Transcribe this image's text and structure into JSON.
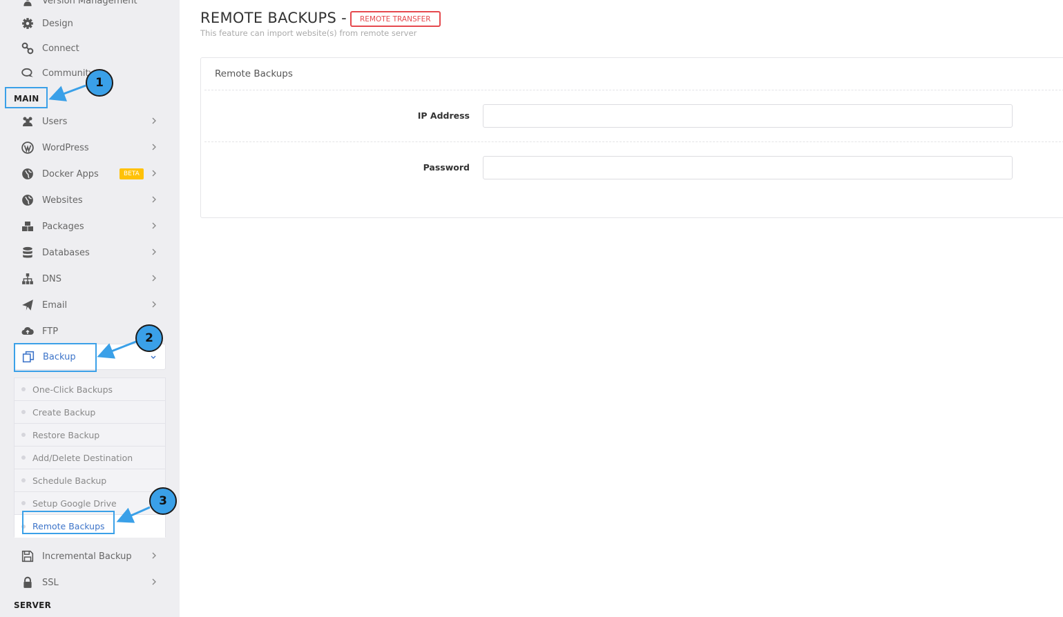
{
  "sidebar": {
    "top_items": [
      {
        "label": "Version Management",
        "icon": "person-icon"
      },
      {
        "label": "Design",
        "icon": "gear-icon"
      },
      {
        "label": "Connect",
        "icon": "link-icon"
      },
      {
        "label": "Community",
        "icon": "chat-icon"
      }
    ],
    "main_header": "MAIN",
    "main_items": [
      {
        "label": "Users",
        "icon": "users-icon"
      },
      {
        "label": "WordPress",
        "icon": "wordpress-icon"
      },
      {
        "label": "Docker Apps",
        "icon": "globe-icon",
        "badge": "BETA"
      },
      {
        "label": "Websites",
        "icon": "globe-icon"
      },
      {
        "label": "Packages",
        "icon": "packages-icon"
      },
      {
        "label": "Databases",
        "icon": "database-icon"
      },
      {
        "label": "DNS",
        "icon": "sitemap-icon"
      },
      {
        "label": "Email",
        "icon": "paper-plane-icon"
      },
      {
        "label": "FTP",
        "icon": "cloud-upload-icon"
      },
      {
        "label": "Backup",
        "icon": "copy-icon"
      }
    ],
    "backup_submenu": [
      {
        "label": "One-Click Backups"
      },
      {
        "label": "Create Backup"
      },
      {
        "label": "Restore Backup"
      },
      {
        "label": "Add/Delete Destination"
      },
      {
        "label": "Schedule Backup"
      },
      {
        "label": "Setup Google Drive"
      },
      {
        "label": "Remote Backups",
        "active": true
      }
    ],
    "bottom_items": [
      {
        "label": "Incremental Backup",
        "icon": "save-icon"
      },
      {
        "label": "SSL",
        "icon": "lock-icon"
      }
    ],
    "server_header": "SERVER"
  },
  "annotations": [
    "1",
    "2",
    "3"
  ],
  "page": {
    "title": "REMOTE BACKUPS -",
    "badge": "REMOTE TRANSFER",
    "subtitle": "This feature can import website(s) from remote server"
  },
  "panel": {
    "title": "Remote Backups",
    "ip_label": "IP Address",
    "ip_value": "",
    "password_label": "Password",
    "password_value": ""
  },
  "colors": {
    "sidebar_bg": "#eeeef1",
    "accent": "#3d74c9",
    "badge_red": "#e5484d",
    "beta_yellow": "#ffc107",
    "annotation_blue": "#3aa0e8"
  }
}
